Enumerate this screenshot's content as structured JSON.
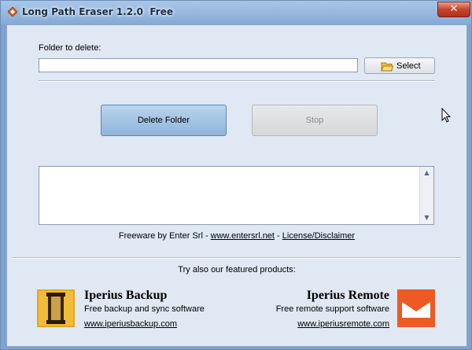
{
  "window": {
    "title": "Long Path Eraser 1.2.0  Free",
    "close_glyph": "✕"
  },
  "folder": {
    "label": "Folder to delete:",
    "value": "",
    "select_label": "Select"
  },
  "actions": {
    "delete_label": "Delete Folder",
    "stop_label": "Stop"
  },
  "log": {
    "content": "",
    "scroll_up_glyph": "▲",
    "scroll_down_glyph": "▼"
  },
  "footer": {
    "prefix": "Freeware by Enter Srl - ",
    "link_site": "www.entersrl.net",
    "separator": " - ",
    "link_license": "License/Disclaimer"
  },
  "featured": {
    "heading": "Try also our featured products:",
    "products": [
      {
        "name": "Iperius Backup",
        "description": "Free backup and sync software",
        "url": "www.iperiusbackup.com",
        "icon": "iperius-backup-logo-icon",
        "color": "#e8a81a"
      },
      {
        "name": "Iperius Remote",
        "description": "Free remote support software",
        "url": "www.iperiusremote.com",
        "icon": "iperius-remote-logo-icon",
        "color": "#ee5a24"
      }
    ]
  },
  "colors": {
    "title_bar": "#86aad6",
    "client_bg": "#dfe8f3",
    "accent_button": "#8fb5da",
    "close_button": "#c6442c"
  }
}
